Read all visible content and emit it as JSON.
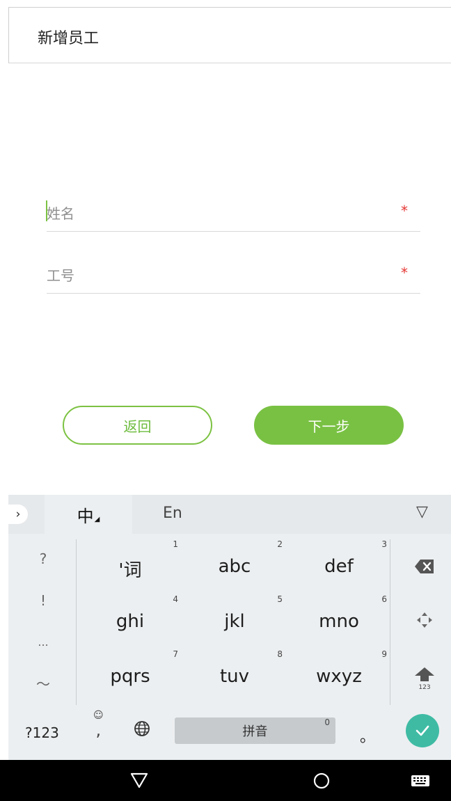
{
  "appbar": {
    "title": "新增员工"
  },
  "form": {
    "name": {
      "placeholder": "姓名",
      "required_mark": "*"
    },
    "employee_no": {
      "placeholder": "工号",
      "required_mark": "*"
    }
  },
  "buttons": {
    "back": "返回",
    "next": "下一步"
  },
  "colors": {
    "accent_green": "#79c143",
    "required_red": "#e53935",
    "enter_teal": "#3fbba4"
  },
  "keyboard": {
    "mode_tabs": {
      "chinese": "中",
      "chinese_corner": "◢",
      "english": "En"
    },
    "expand": "›",
    "collapse": "▽",
    "symbols": [
      "?",
      "!",
      "...",
      "～"
    ],
    "keys": [
      {
        "label": "'词",
        "num": "1"
      },
      {
        "label": "abc",
        "num": "2"
      },
      {
        "label": "def",
        "num": "3"
      },
      {
        "label": "ghi",
        "num": "4"
      },
      {
        "label": "jkl",
        "num": "5"
      },
      {
        "label": "mno",
        "num": "6"
      },
      {
        "label": "pqrs",
        "num": "7"
      },
      {
        "label": "tuv",
        "num": "8"
      },
      {
        "label": "wxyz",
        "num": "9"
      }
    ],
    "shift_sub": "123",
    "bottom": {
      "symbols_key": "?123",
      "emoji": "☺",
      "comma": ",",
      "space": "拼音",
      "space_num": "0",
      "period": "。"
    },
    "icons": {
      "backspace": "backspace-icon",
      "cursor_move": "cursor-move-icon",
      "shift": "shift-icon",
      "globe": "globe-icon",
      "enter": "check-icon"
    }
  },
  "navbar": {
    "icons": [
      "back-triangle-icon",
      "home-circle-icon",
      "keyboard-icon"
    ]
  }
}
